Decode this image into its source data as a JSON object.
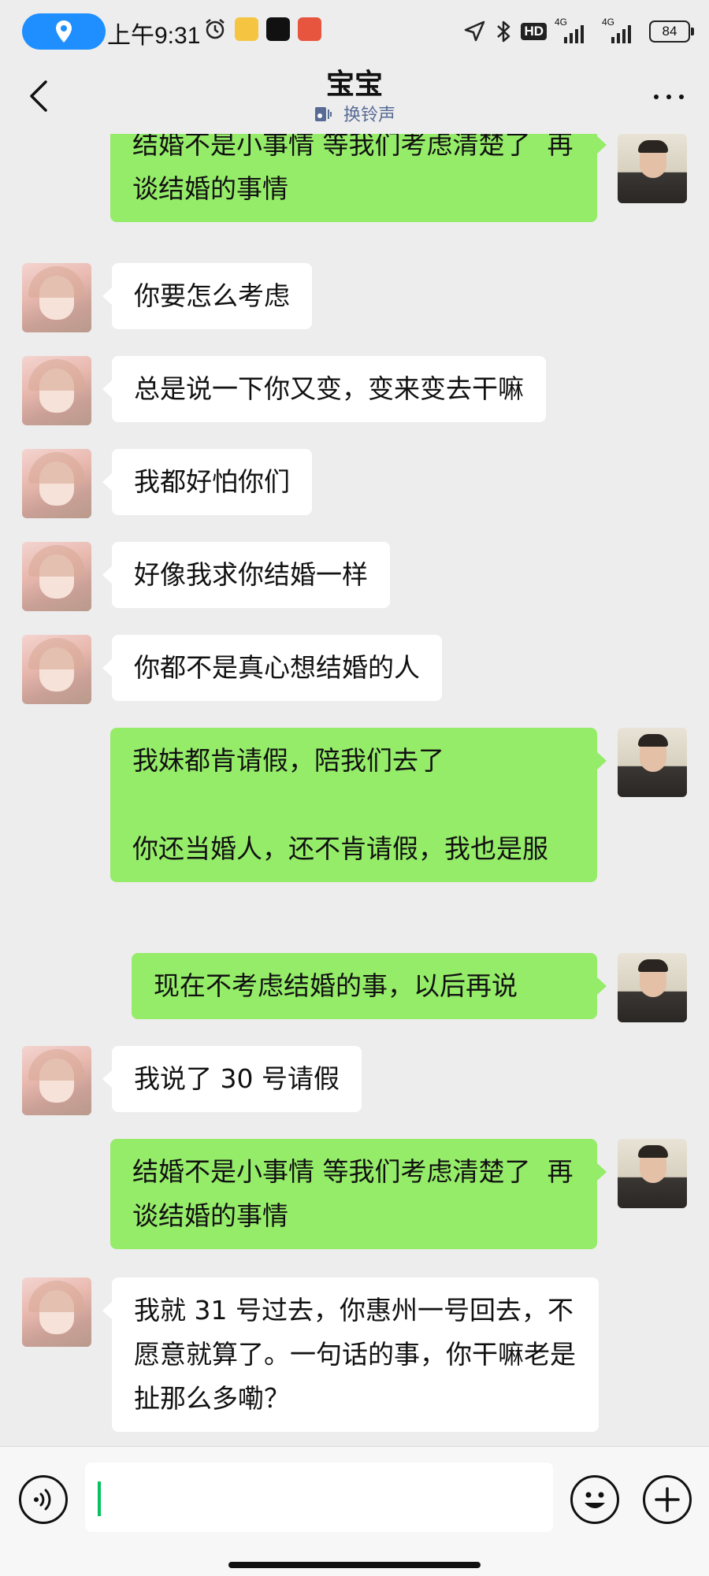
{
  "status_bar": {
    "time": "上午9:31",
    "network_type": "HD",
    "signal_1": "4G",
    "signal_2": "4G",
    "battery": "84"
  },
  "header": {
    "title": "宝宝",
    "subtitle": "换铃声"
  },
  "messages": [
    {
      "side": "out",
      "text": "结婚不是小事情 等我们考虑清楚了  再谈结婚的事情"
    },
    {
      "side": "in",
      "text": "你要怎么考虑"
    },
    {
      "side": "in",
      "text": "总是说一下你又变，变来变去干嘛"
    },
    {
      "side": "in",
      "text": "我都好怕你们"
    },
    {
      "side": "in",
      "text": "好像我求你结婚一样"
    },
    {
      "side": "in",
      "text": "你都不是真心想结婚的人"
    },
    {
      "side": "out",
      "text": "我妹都肯请假，陪我们去了\n\n你还当婚人，还不肯请假，我也是服"
    },
    {
      "side": "out",
      "text": "现在不考虑结婚的事，以后再说"
    },
    {
      "side": "in",
      "text": "我说了 30 号请假"
    },
    {
      "side": "out",
      "text": "结婚不是小事情 等我们考虑清楚了  再谈结婚的事情"
    },
    {
      "side": "in",
      "text": "我就 31 号过去，你惠州一号回去，不愿意就算了。一句话的事，你干嘛老是扯那么多嘞？"
    }
  ],
  "input": {
    "value": ""
  },
  "colors": {
    "background": "#ededed",
    "outgoing_bubble": "#95ec69",
    "incoming_bubble": "#ffffff",
    "subtitle": "#576b95",
    "caret": "#07c160",
    "location_pill": "#1f8fff"
  },
  "icons": {
    "location": "location-pin-icon",
    "alarm": "alarm-icon",
    "navigation": "navigation-arrow-icon",
    "bluetooth": "bluetooth-icon",
    "back": "chevron-left-icon",
    "more": "more-dots-icon",
    "ringtone": "ringtone-icon",
    "voice": "voice-icon",
    "emoji": "emoji-icon",
    "plus": "plus-icon"
  }
}
